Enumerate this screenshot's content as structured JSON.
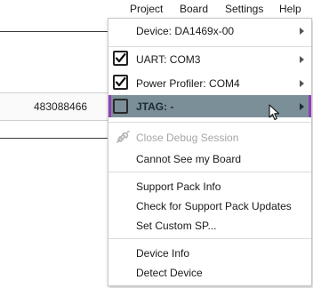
{
  "menubar": {
    "items": [
      {
        "label": "Project"
      },
      {
        "label": "Board"
      },
      {
        "label": "Settings"
      },
      {
        "label": "Help"
      }
    ]
  },
  "background": {
    "serial_number": "483088466"
  },
  "menu": {
    "device": {
      "label": "Device: DA1469x-00"
    },
    "uart": {
      "label": "UART: COM3",
      "checked": true
    },
    "power_profiler": {
      "label": "Power Profiler: COM4",
      "checked": true
    },
    "jtag": {
      "label": "JTAG: -",
      "checked": false,
      "highlighted": true
    },
    "close_debug": {
      "label": "Close Debug Session",
      "disabled": true
    },
    "cannot_see": {
      "label": "Cannot See my Board"
    },
    "support_pack_info": {
      "label": "Support Pack Info"
    },
    "check_updates": {
      "label": "Check for Support Pack Updates"
    },
    "set_custom_sp": {
      "label": "Set Custom SP..."
    },
    "device_info": {
      "label": "Device Info"
    },
    "detect_device": {
      "label": "Detect Device"
    }
  },
  "colors": {
    "highlight_bg": "#7b8f99",
    "highlight_border": "#8e3fb8",
    "disabled_text": "#a6a6a6"
  }
}
